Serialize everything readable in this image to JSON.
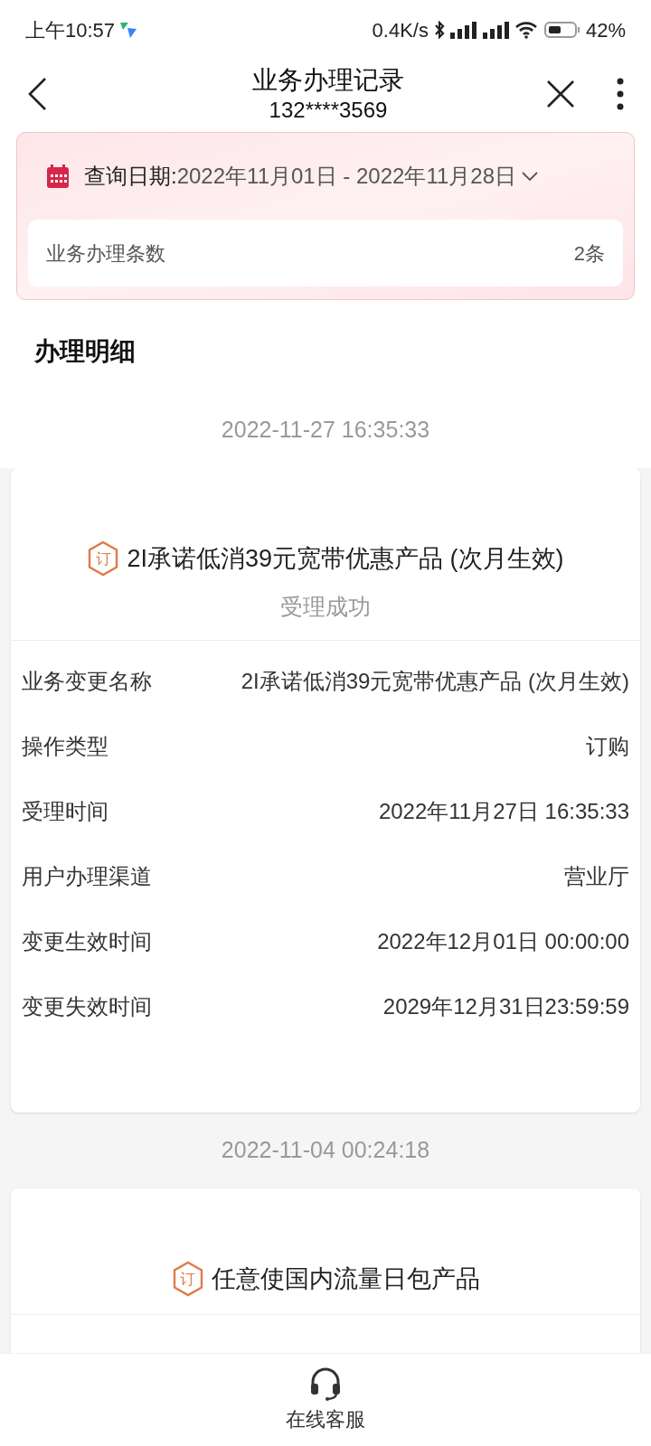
{
  "status_bar": {
    "time": "上午10:57",
    "speed": "0.4K/s",
    "battery": "42%"
  },
  "header": {
    "title": "业务办理记录",
    "subtitle": "132****3569"
  },
  "query": {
    "label": "查询日期:",
    "range": "2022年11月01日 - 2022年11月28日",
    "count_label": "业务办理条数",
    "count": "2条"
  },
  "section_title": "办理明细",
  "records": [
    {
      "time": "2022-11-27 16:35:33",
      "badge": "订",
      "title": "2I承诺低消39元宽带优惠产品 (次月生效)",
      "status": "受理成功",
      "details": [
        {
          "label": "业务变更名称",
          "value": "2I承诺低消39元宽带优惠产品 (次月生效)"
        },
        {
          "label": "操作类型",
          "value": "订购"
        },
        {
          "label": "受理时间",
          "value": "2022年11月27日 16:35:33"
        },
        {
          "label": "用户办理渠道",
          "value": "营业厅"
        },
        {
          "label": "变更生效时间",
          "value": "2022年12月01日 00:00:00"
        },
        {
          "label": "变更失效时间",
          "value": "2029年12月31日23:59:59"
        }
      ]
    },
    {
      "time": "2022-11-04 00:24:18",
      "badge": "订",
      "title": "任意使国内流量日包产品"
    }
  ],
  "bottom_bar": {
    "label": "在线客服"
  }
}
